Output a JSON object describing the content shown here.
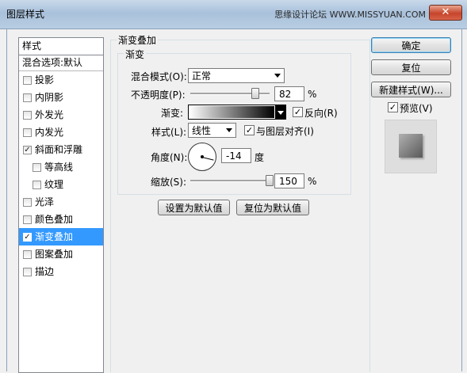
{
  "window": {
    "title": "图层样式",
    "watermark": "思缘设计论坛 WWW.MISSYUAN.COM",
    "close_glyph": "✕"
  },
  "style_list": {
    "header": "样式",
    "blend_options": "混合选项:默认",
    "items": [
      {
        "label": "投影",
        "checked": false,
        "sub": false,
        "selected": false
      },
      {
        "label": "内阴影",
        "checked": false,
        "sub": false,
        "selected": false
      },
      {
        "label": "外发光",
        "checked": false,
        "sub": false,
        "selected": false
      },
      {
        "label": "内发光",
        "checked": false,
        "sub": false,
        "selected": false
      },
      {
        "label": "斜面和浮雕",
        "checked": true,
        "sub": false,
        "selected": false
      },
      {
        "label": "等高线",
        "checked": false,
        "sub": true,
        "selected": false
      },
      {
        "label": "纹理",
        "checked": false,
        "sub": true,
        "selected": false
      },
      {
        "label": "光泽",
        "checked": false,
        "sub": false,
        "selected": false
      },
      {
        "label": "颜色叠加",
        "checked": false,
        "sub": false,
        "selected": false
      },
      {
        "label": "渐变叠加",
        "checked": true,
        "sub": false,
        "selected": true
      },
      {
        "label": "图案叠加",
        "checked": false,
        "sub": false,
        "selected": false
      },
      {
        "label": "描边",
        "checked": false,
        "sub": false,
        "selected": false
      }
    ]
  },
  "panel": {
    "group_title": "渐变叠加",
    "inner_title": "渐变",
    "blend_mode_label": "混合模式(O):",
    "blend_mode_value": "正常",
    "opacity_label": "不透明度(P):",
    "opacity_value": "82",
    "opacity_unit": "%",
    "opacity_fraction": 0.82,
    "gradient_label": "渐变:",
    "reverse_label": "反向(R)",
    "reverse_checked": true,
    "style_label": "样式(L):",
    "style_value": "线性",
    "align_label": "与图层对齐(I)",
    "align_checked": true,
    "angle_label": "角度(N):",
    "angle_value": "-14",
    "angle_unit": "度",
    "scale_label": "缩放(S):",
    "scale_value": "150",
    "scale_unit": "%",
    "scale_fraction": 1.0,
    "set_default_button": "设置为默认值",
    "reset_default_button": "复位为默认值"
  },
  "right": {
    "ok_button": "确定",
    "reset_button": "复位",
    "new_style_button": "新建样式(W)...",
    "preview_label": "预览(V)",
    "preview_checked": true
  },
  "check_glyph": "✓"
}
